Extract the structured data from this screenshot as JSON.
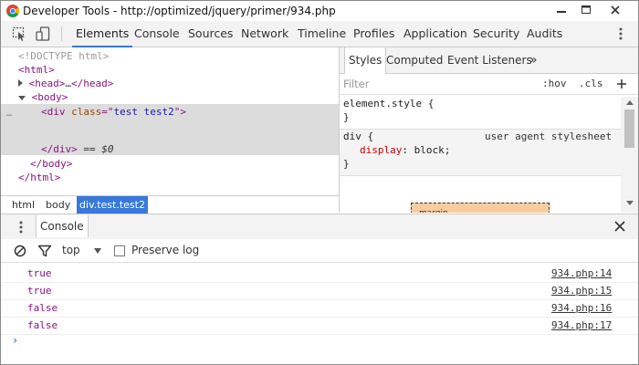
{
  "window": {
    "title": "Developer Tools - http://optimized/jquery/primer/934.php"
  },
  "toolbar": {
    "tabs": [
      "Elements",
      "Console",
      "Sources",
      "Network",
      "Timeline",
      "Profiles",
      "Application",
      "Security",
      "Audits"
    ],
    "active_tab": "Elements"
  },
  "elements": {
    "doctype": "<!DOCTYPE html>",
    "html_open": "<html>",
    "head_open": "<head>",
    "head_ellipsis": "…",
    "head_close": "</head>",
    "body_open": "<body>",
    "div_open_start": "<div",
    "div_attr_name": "class",
    "div_attr_eq": "=\"",
    "div_attr_value": "test test2",
    "div_attr_end": "\">",
    "div_close": "</div>",
    "div_eq": "==",
    "div_dollar": "$0",
    "body_close": "</body>",
    "html_close": "</html>",
    "selection_dots": "…"
  },
  "breadcrumbs": {
    "items": [
      "html",
      "body"
    ],
    "active": "div.test.test2"
  },
  "styles": {
    "tabs": [
      "Styles",
      "Computed",
      "Event Listeners"
    ],
    "more": "»",
    "active_tab": "Styles",
    "filter_placeholder": "Filter",
    "hov": ":hov",
    "cls": ".cls",
    "plus": "+",
    "element_style_selector": "element.style {",
    "close_brace": "}",
    "ua_selector": "div {",
    "ua_label": "user agent stylesheet",
    "ua_prop_name": "display",
    "ua_prop_sep": ": ",
    "ua_prop_value": "block;",
    "box_model_label": "margin"
  },
  "drawer": {
    "tab": "Console"
  },
  "console": {
    "context": "top",
    "preserve_log": "Preserve log",
    "preserve_checked": false,
    "messages": [
      {
        "value": "true",
        "source": "934.php:14"
      },
      {
        "value": "true",
        "source": "934.php:15"
      },
      {
        "value": "false",
        "source": "934.php:16"
      },
      {
        "value": "false",
        "source": "934.php:17"
      }
    ],
    "prompt": "›"
  },
  "colors": {
    "accent": "#3879d9",
    "tag": "#881280",
    "attr": "#994500",
    "attr_value": "#1a1aa6",
    "css_prop": "#c80000",
    "box_margin": "#f9cc9d"
  }
}
